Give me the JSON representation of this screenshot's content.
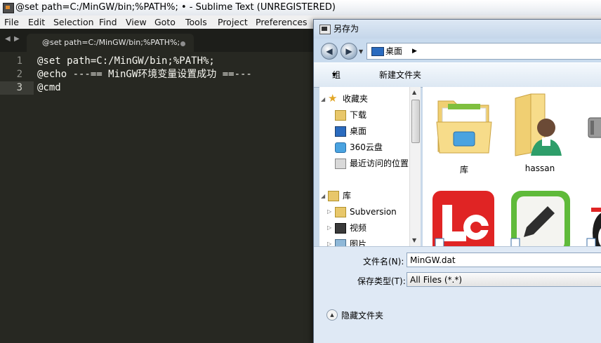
{
  "window": {
    "title": "@set path=C:/MinGW/bin;%PATH%; • - Sublime Text (UNREGISTERED)"
  },
  "menu": [
    "File",
    "Edit",
    "Selection",
    "Find",
    "View",
    "Goto",
    "Tools",
    "Project",
    "Preferences"
  ],
  "tab": {
    "label": "@set path=C:/MinGW/bin;%PATH%;"
  },
  "editor": {
    "lines": [
      {
        "num": "1",
        "text": "@set path=C:/MinGW/bin;%PATH%;"
      },
      {
        "num": "2",
        "text": "@echo ---== MinGW环境变量设置成功 ==---"
      },
      {
        "num": "3",
        "text": "@cmd"
      }
    ]
  },
  "dialog": {
    "title": "另存为",
    "address": "桌面",
    "toolbar": {
      "organize": "组织",
      "new_folder": "新建文件夹"
    },
    "nav": {
      "favorites": "收藏夹",
      "downloads": "下载",
      "desktop": "桌面",
      "cloud": "360云盘",
      "recent": "最近访问的位置",
      "libraries": "库",
      "subversion": "Subversion",
      "videos": "视频",
      "pictures": "图片"
    },
    "files": [
      {
        "name": "库"
      },
      {
        "name": "hassan"
      }
    ],
    "filename_label": "文件名(N):",
    "filename_value": "MinGW.dat",
    "filetype_label": "保存类型(T):",
    "filetype_value": "All Files (*.*)",
    "hide_folders": "隐藏文件夹"
  }
}
